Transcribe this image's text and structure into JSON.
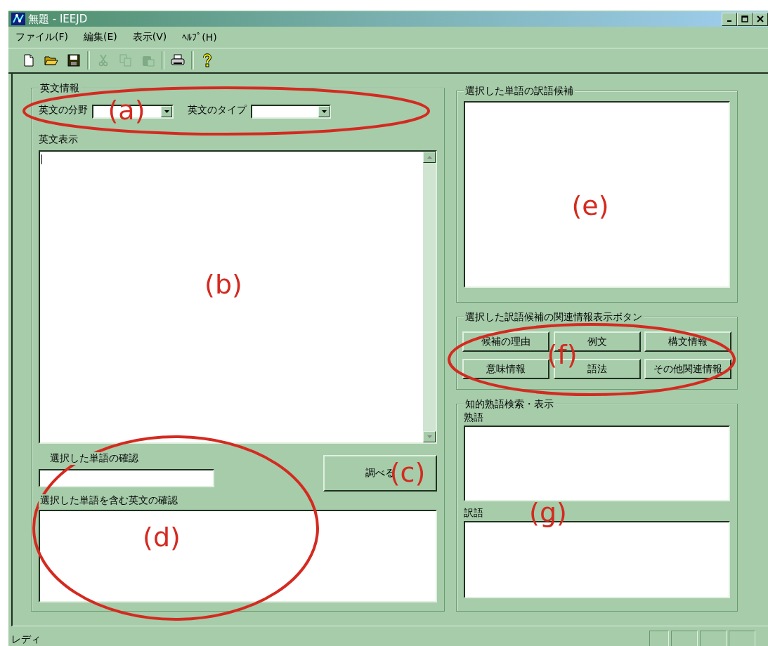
{
  "window": {
    "title": "無題 - IEEJD"
  },
  "menu": [
    "ファイル(F)",
    "編集(E)",
    "表示(V)",
    "ﾍﾙﾌﾟ(H)"
  ],
  "toolbar": [
    {
      "kind": "new",
      "disabled": false
    },
    {
      "kind": "open",
      "disabled": false
    },
    {
      "kind": "save",
      "disabled": false
    },
    {
      "kind": "cut",
      "disabled": true
    },
    {
      "kind": "copy",
      "disabled": true
    },
    {
      "kind": "paste",
      "disabled": true
    },
    {
      "kind": "print",
      "disabled": false
    },
    {
      "kind": "help",
      "disabled": false
    }
  ],
  "english_info": {
    "legend": "英文情報",
    "field_label": "英文の分野",
    "type_label": "英文のタイプ",
    "display_label": "英文表示"
  },
  "word_check": {
    "label": "選択した単語の確認"
  },
  "lookup_button": "調べる",
  "sentence_check": {
    "label": "選択した単語を含む英文の確認"
  },
  "candidates": {
    "legend": "選択した単語の訳語候補"
  },
  "related": {
    "legend": "選択した訳語候補の関連情報表示ボタン",
    "buttons": [
      "候補の理由",
      "例文",
      "構文情報",
      "意味情報",
      "語法",
      "その他関連情報"
    ]
  },
  "idiom": {
    "legend": "知的熟語検索・表示",
    "idiom_label": "熟語",
    "translation_label": "訳語"
  },
  "status_bar": {
    "text": "レディ"
  },
  "annotations": [
    {
      "label": "(a)",
      "circled": true
    },
    {
      "label": "(b)",
      "circled": false
    },
    {
      "label": "(c)",
      "circled": false
    },
    {
      "label": "(d)",
      "circled": true
    },
    {
      "label": "(e)",
      "circled": false
    },
    {
      "label": "(f)",
      "circled": true
    },
    {
      "label": "(g)",
      "circled": false
    }
  ]
}
